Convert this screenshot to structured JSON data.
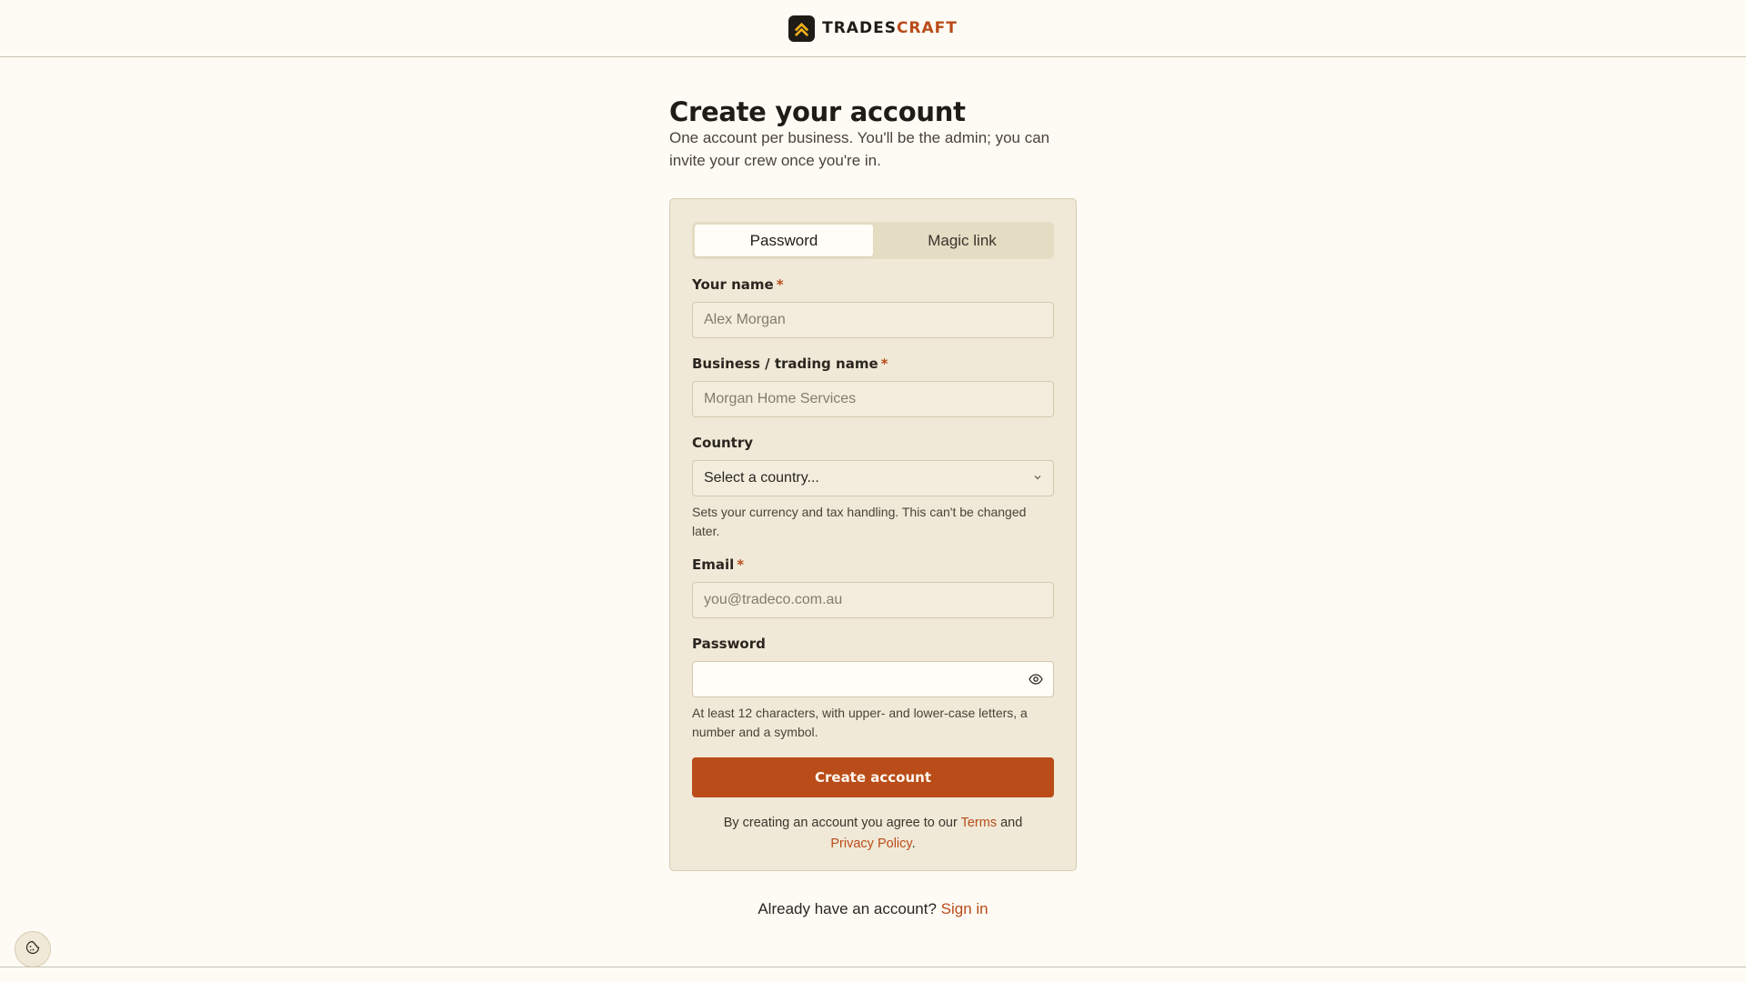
{
  "brand": {
    "name_part1": "TRADES",
    "name_part2": "CRAFT",
    "logo_icon": "chevron-up-icon",
    "accent_color": "#b94c19"
  },
  "header": {
    "title": "Create your account",
    "subtitle": "One account per business. You'll be the admin; you can invite your crew once you're in."
  },
  "auth_tabs": {
    "items": [
      {
        "label": "Password",
        "active": true
      },
      {
        "label": "Magic link",
        "active": false
      }
    ]
  },
  "form": {
    "name": {
      "label": "Your name",
      "required_mark": "*",
      "placeholder": "Alex Morgan",
      "value": ""
    },
    "business": {
      "label": "Business / trading name",
      "required_mark": "*",
      "placeholder": "Morgan Home Services",
      "value": ""
    },
    "country": {
      "label": "Country",
      "selected": "Select a country...",
      "hint": "Sets your currency and tax handling. This can't be changed later."
    },
    "email": {
      "label": "Email",
      "required_mark": "*",
      "placeholder": "you@tradeco.com.au",
      "value": ""
    },
    "password": {
      "label": "Password",
      "value": "",
      "toggle_icon": "eye-icon",
      "hint": "At least 12 characters, with upper- and lower-case letters, a number and a symbol."
    },
    "submit_label": "Create account",
    "legal": {
      "prefix": "By creating an account you agree to our ",
      "terms_label": "Terms",
      "and": " and ",
      "privacy_label": "Privacy Policy",
      "suffix": "."
    }
  },
  "signin": {
    "prompt": "Already have an account? ",
    "link_label": "Sign in"
  },
  "cookie": {
    "icon": "cookie-icon"
  }
}
